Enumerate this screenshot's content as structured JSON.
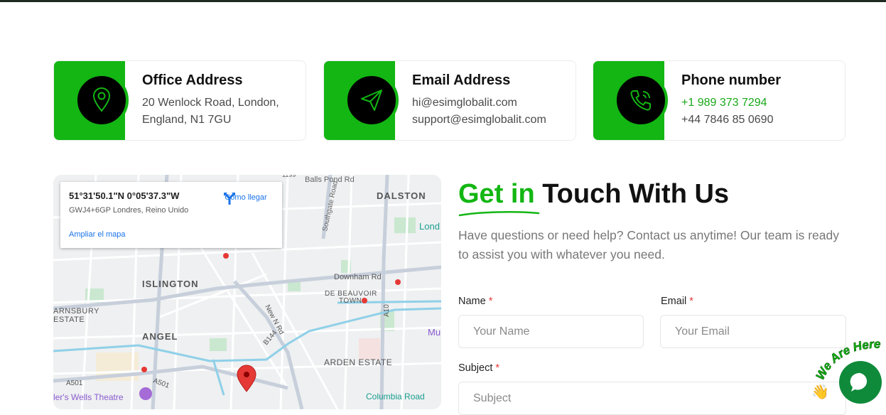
{
  "cards": [
    {
      "title": "Office Address",
      "line1": "20 Wenlock Road, London,",
      "line2": "England, N1 7GU",
      "icon": "location-pin-icon"
    },
    {
      "title": "Email Address",
      "line1": "hi@esimglobalit.com",
      "line2": "support@esimglobalit.com",
      "icon": "paper-plane-icon"
    },
    {
      "title": "Phone number",
      "line1": "+1 989 373 7294",
      "line2": "+44 7846 85 0690",
      "icon": "phone-call-icon"
    }
  ],
  "map": {
    "coords": "51°31'50.1\"N 0°05'37.3\"W",
    "plus_code": "GWJ4+6GP Londres, Reino Unido",
    "directions": "Cómo llegar",
    "enlarge": "Ampliar el mapa",
    "labels": {
      "balls_pond": "Balls Pond Rd",
      "dalston": "DALSTON",
      "lond": "Lond",
      "southgate": "Southgate Road",
      "islington": "ISLINGTON",
      "downham": "Downham Rd",
      "de_beauvoir": "DE BEAUVOIR",
      "town": "TOWN",
      "barnsbury": "ARNSBURY",
      "estate": "ESTATE",
      "angel": "ANGEL",
      "new_n_rd": "New N Rd",
      "b144": "B144",
      "a10": "A10",
      "mu": "Mu",
      "arden": "ARDEN ESTATE",
      "a501": "A501",
      "a501b": "A501",
      "theatre": "ler's Wells Theatre",
      "columbia": "Columbia Road",
      "road_1199": "1199"
    }
  },
  "contact": {
    "heading_accent": "Get in",
    "heading_rest": "Touch With Us",
    "description": "Have questions or need help? Contact us anytime! Our team is ready to assist you with whatever you need.",
    "name_label": "Name",
    "email_label": "Email",
    "subject_label": "Subject",
    "required_mark": "*",
    "name_placeholder": "Your Name",
    "email_placeholder": "Your Email",
    "subject_placeholder": "Subject"
  },
  "badge_text": "We Are Here",
  "colors": {
    "accent": "#13b613",
    "chat": "#0f8a3a"
  }
}
